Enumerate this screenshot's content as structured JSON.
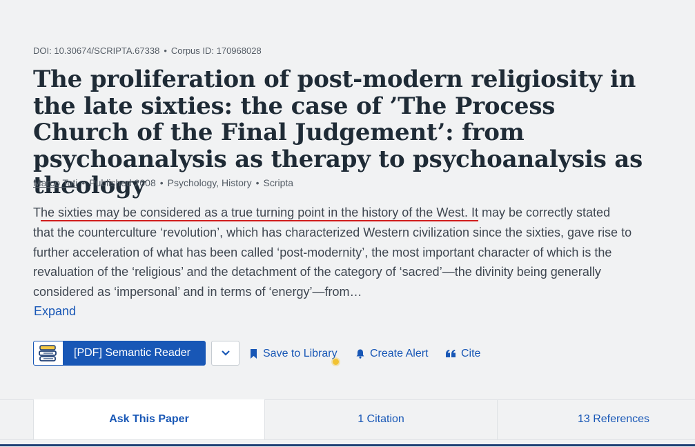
{
  "paper": {
    "doi": "DOI: 10.30674/SCRIPTA.67338",
    "corpus_id": "Corpus ID: 170968028",
    "title": "The proliferation of post-modern religiosity in the late sixties: the case of ’The Process Church of the Final Judgement’: from psychoanalysis as therapy to psychoanalysis as theology",
    "author": "Marco Toti",
    "published": "Published 2008",
    "fields": "Psychology, History",
    "venue": "Scripta",
    "abstract_first_T": "T",
    "abstract_underlined": "he sixties may be considered as a true turning point in the history of the West. It",
    "abstract_rest": " may be correctly stated that the counterculture ‘revolution’, which has characterized Western civilization since the sixties, gave rise to further acceleration of what has been called ‘post-modernity’, the most important character of which is the revaluation of the ‘religious’ and the detachment of the category of ‘sacred’—the divinity being generally considered as ‘impersonal’ and in terms of ‘energy’—from…",
    "expand_label": "Expand"
  },
  "actions": {
    "pdf_label": "[PDF] Semantic Reader",
    "save_label": "Save to Library",
    "alert_label": "Create Alert",
    "cite_label": "Cite"
  },
  "tabs": {
    "ask": "Ask This Paper",
    "citations": "1 Citation",
    "references": "13 References"
  },
  "colors": {
    "link": "#1857b6",
    "annotation": "#d01c1c"
  },
  "icons": [
    "book-icon",
    "chevron-down-icon",
    "bookmark-icon",
    "bell-icon",
    "quote-icon"
  ]
}
